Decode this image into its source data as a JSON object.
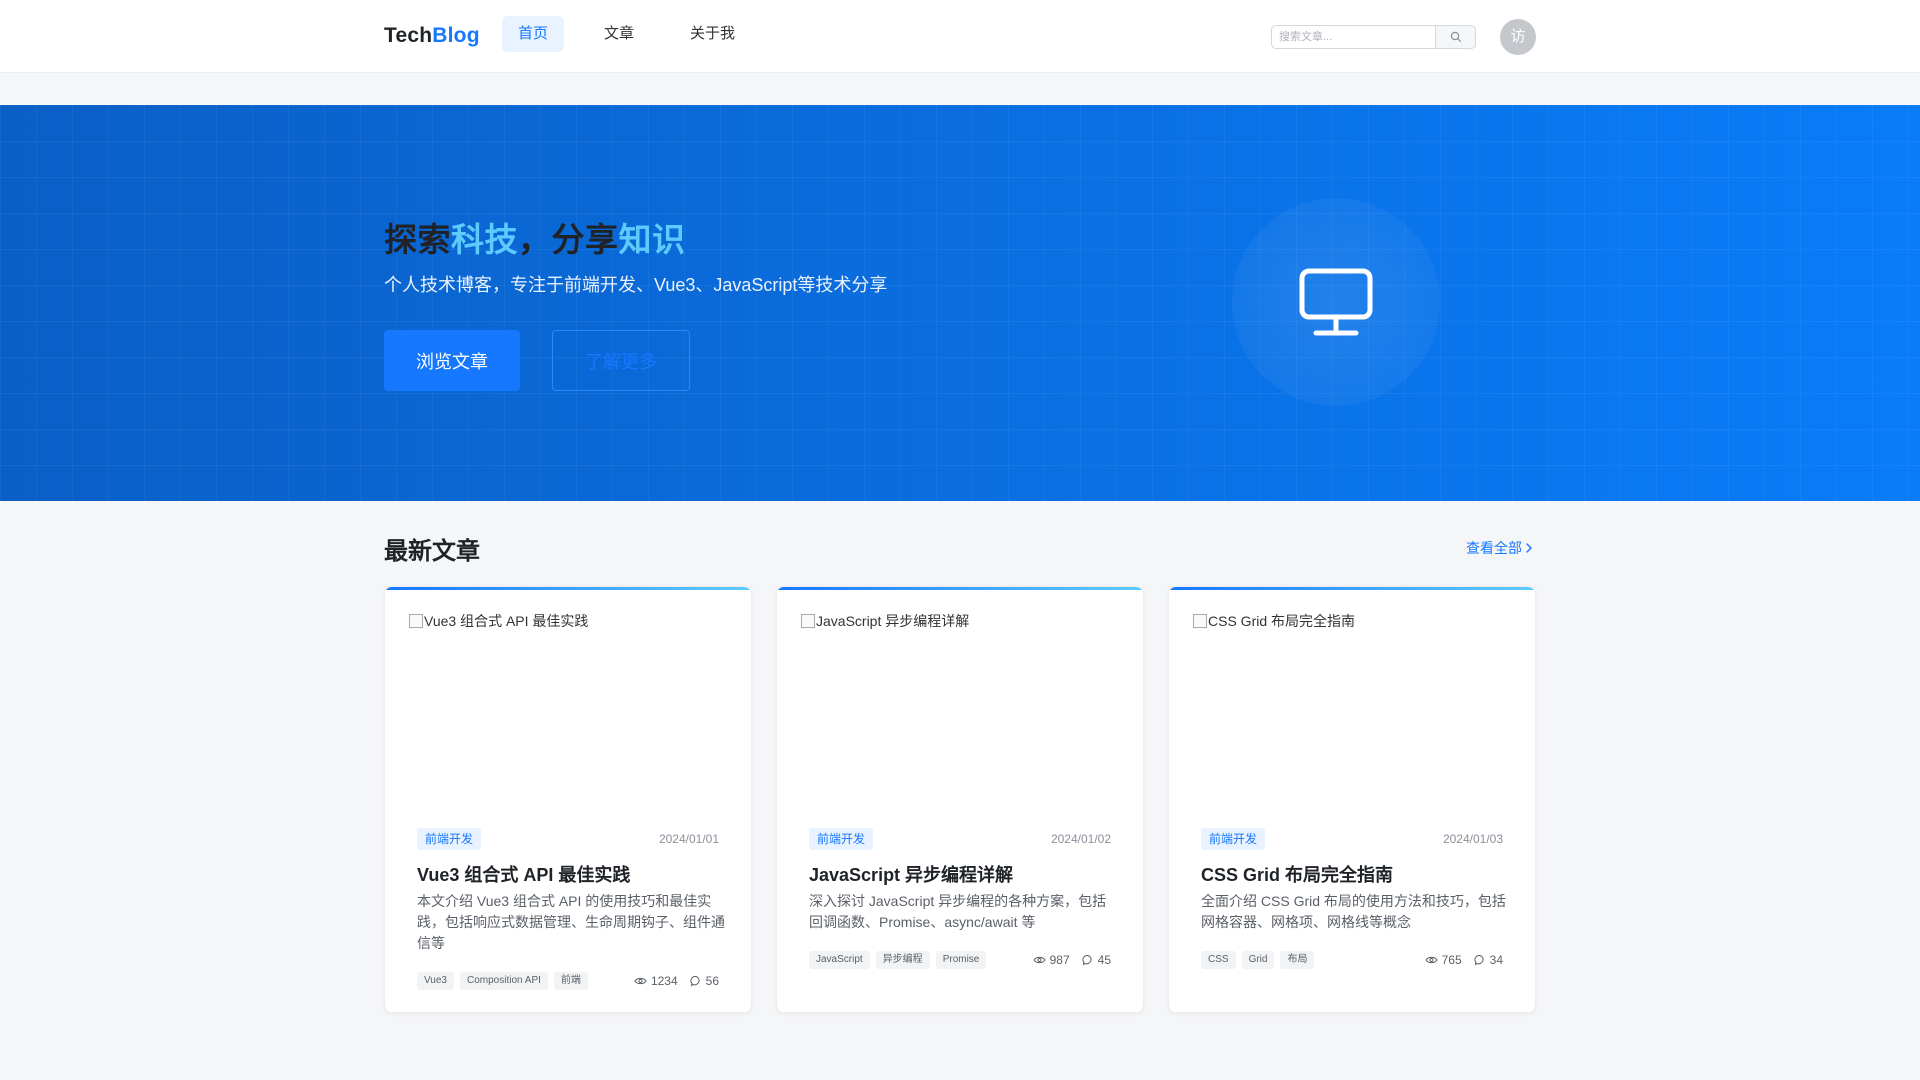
{
  "header": {
    "logo_a": "Tech",
    "logo_b": "Blog",
    "nav": [
      {
        "label": "首页",
        "active": true
      },
      {
        "label": "文章",
        "active": false
      },
      {
        "label": "关于我",
        "active": false
      }
    ],
    "search_placeholder": "搜索文章...",
    "avatar_text": "访"
  },
  "hero": {
    "title_1": "探索",
    "title_2": "科技",
    "title_3": "，分享",
    "title_4": "知识",
    "subtitle": "个人技术博客，专注于前端开发、Vue3、JavaScript等技术分享",
    "primary_button": "浏览文章",
    "secondary_button": "了解更多",
    "icon": "monitor-icon"
  },
  "latest": {
    "title": "最新文章",
    "view_all": "查看全部",
    "articles": [
      {
        "image_alt": "Vue3 组合式 API 最佳实践",
        "category": "前端开发",
        "date": "2024/01/01",
        "title": "Vue3 组合式 API 最佳实践",
        "description": "本文介绍 Vue3 组合式 API 的使用技巧和最佳实践，包括响应式数据管理、生命周期钩子、组件通信等",
        "tags": [
          "Vue3",
          "Composition API",
          "前端"
        ],
        "views": "1234",
        "comments": "56"
      },
      {
        "image_alt": "JavaScript 异步编程详解",
        "category": "前端开发",
        "date": "2024/01/02",
        "title": "JavaScript 异步编程详解",
        "description": "深入探讨 JavaScript 异步编程的各种方案，包括回调函数、Promise、async/await 等",
        "tags": [
          "JavaScript",
          "异步编程",
          "Promise"
        ],
        "views": "987",
        "comments": "45"
      },
      {
        "image_alt": "CSS Grid 布局完全指南",
        "category": "前端开发",
        "date": "2024/01/03",
        "title": "CSS Grid 布局完全指南",
        "description": "全面介绍 CSS Grid 布局的使用方法和技巧，包括网格容器、网格项、网格线等概念",
        "tags": [
          "CSS",
          "Grid",
          "布局"
        ],
        "views": "765",
        "comments": "34"
      }
    ]
  },
  "colors": {
    "accent": "#1677ff",
    "hero_gradient_start": "#0a5fc6",
    "hero_gradient_end": "#0a7cf8",
    "highlight": "#5ecbff"
  }
}
